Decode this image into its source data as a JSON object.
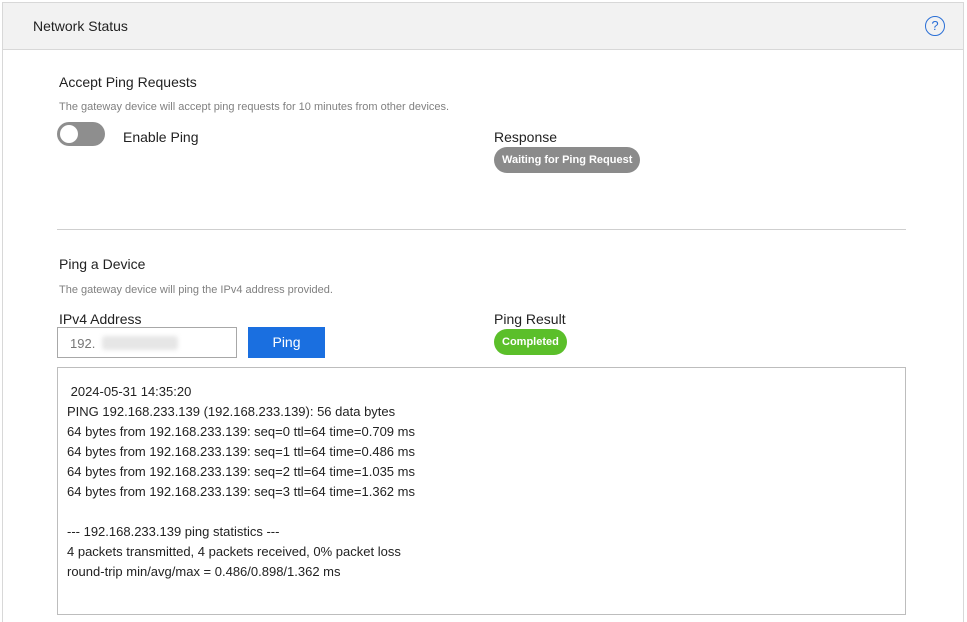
{
  "header": {
    "title": "Network Status",
    "help_icon": "help-circle-icon"
  },
  "accept_ping": {
    "title": "Accept Ping Requests",
    "description": "The gateway device will accept ping requests for 10 minutes from other devices.",
    "toggle_label": "Enable Ping",
    "toggle_on": false,
    "response_label": "Response",
    "response_status": "Waiting for Ping Request"
  },
  "ping_device": {
    "title": "Ping a Device",
    "description": "The gateway device will ping the IPv4 address provided.",
    "ipv4_label": "IPv4 Address",
    "ipv4_value": "192.",
    "ping_button": "Ping",
    "result_label": "Ping Result",
    "result_status": "Completed",
    "output": [
      " 2024-05-31 14:35:20",
      "PING 192.168.233.139 (192.168.233.139): 56 data bytes",
      "64 bytes from 192.168.233.139: seq=0 ttl=64 time=0.709 ms",
      "64 bytes from 192.168.233.139: seq=1 ttl=64 time=0.486 ms",
      "64 bytes from 192.168.233.139: seq=2 ttl=64 time=1.035 ms",
      "64 bytes from 192.168.233.139: seq=3 ttl=64 time=1.362 ms",
      "",
      "--- 192.168.233.139 ping statistics ---",
      "4 packets transmitted, 4 packets received, 0% packet loss",
      "round-trip min/avg/max = 0.486/0.898/1.362 ms"
    ]
  },
  "colors": {
    "accent": "#1a6fe0",
    "status_waiting": "#8b8b8b",
    "status_completed": "#5bbf2a"
  }
}
